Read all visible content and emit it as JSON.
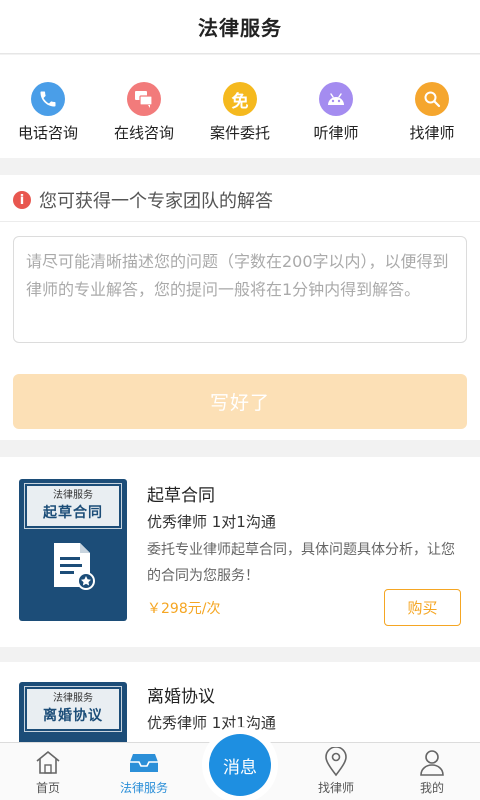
{
  "header": {
    "title": "法律服务"
  },
  "quick_actions": [
    {
      "label": "电话咨询",
      "icon": "phone-icon",
      "color": "#4a9ee8"
    },
    {
      "label": "在线咨询",
      "icon": "chat-icon",
      "color": "#f27b7b"
    },
    {
      "label": "案件委托",
      "icon": "free-icon",
      "icon_text": "免",
      "color": "#f5b91e"
    },
    {
      "label": "听律师",
      "icon": "android-icon",
      "color": "#a48cf0"
    },
    {
      "label": "找律师",
      "icon": "search-icon",
      "color": "#f5a62e"
    }
  ],
  "ask": {
    "tip": "您可获得一个专家团队的解答",
    "placeholder": "请尽可能清晰描述您的问题（字数在200字以内），以便得到律师的专业解答，您的提问一般将在1分钟内得到解答。",
    "submit_label": "写好了"
  },
  "services": [
    {
      "plate_top": "法律服务",
      "plate_main": "起草合同",
      "title": "起草合同",
      "subtitle": "优秀律师 1对1沟通",
      "description": "委托专业律师起草合同，具体问题具体分析，让您的合同为您服务！",
      "price": "￥298元/次",
      "buy_label": "购买"
    },
    {
      "plate_top": "法律服务",
      "plate_main": "离婚协议",
      "title": "离婚协议",
      "subtitle": "优秀律师 1对1沟通"
    }
  ],
  "tabbar": {
    "tabs": [
      {
        "label": "首页",
        "icon": "home-icon"
      },
      {
        "label": "法律服务",
        "icon": "inbox-icon",
        "active": true
      },
      {
        "label": "找律师",
        "icon": "location-pin-icon"
      },
      {
        "label": "我的",
        "icon": "user-icon"
      }
    ],
    "center_label": "消息"
  },
  "colors": {
    "accent_blue": "#2b8fd8",
    "price_orange": "#f5a623",
    "submit_disabled": "#fce0b6",
    "thumb_navy": "#1c4d78"
  }
}
